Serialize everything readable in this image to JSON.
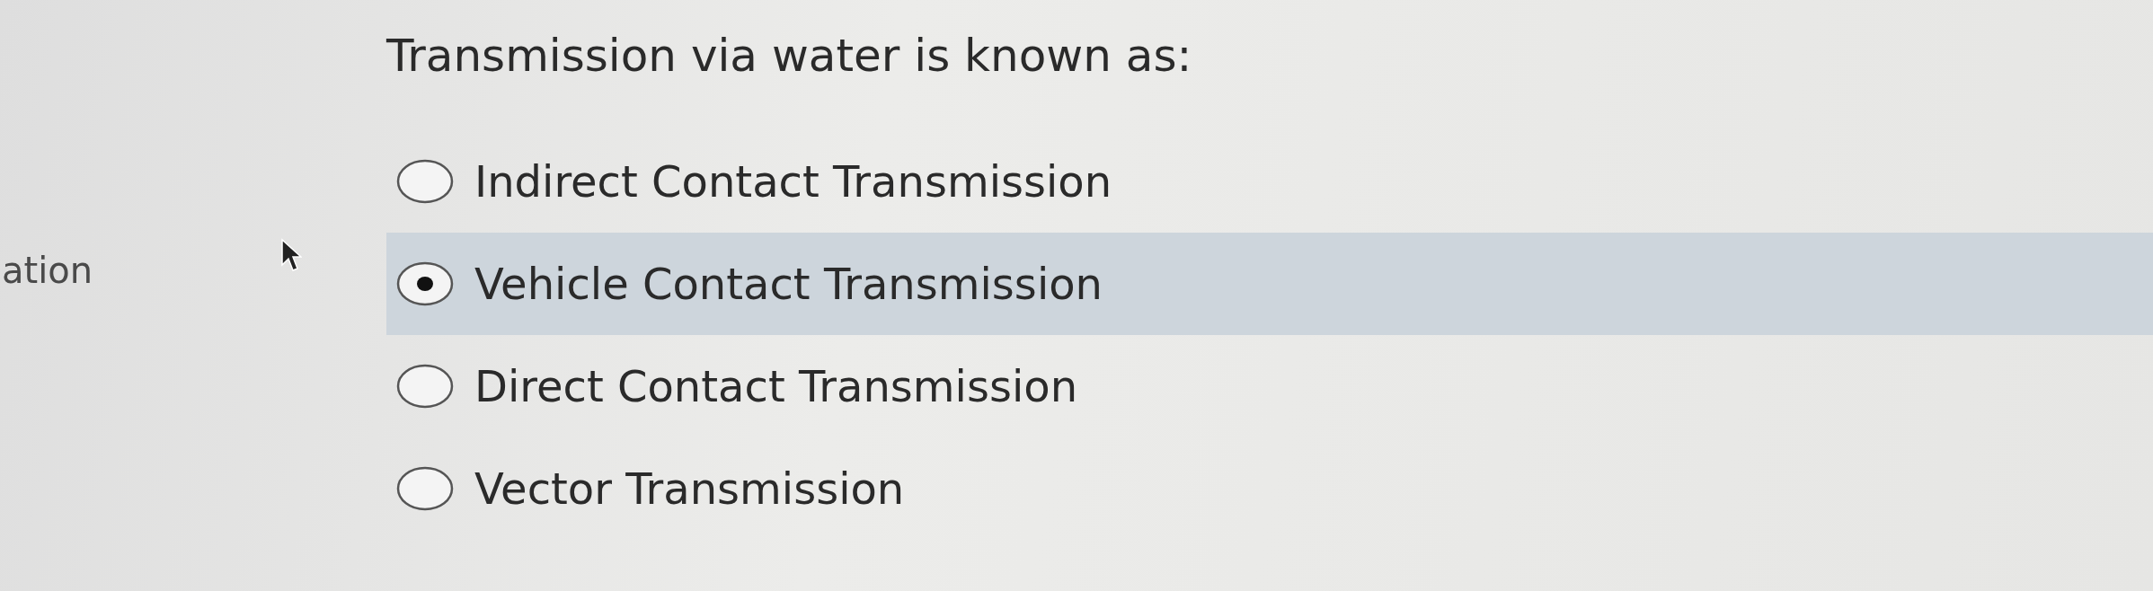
{
  "side_label": "ation",
  "question": "Transmission via water is known as:",
  "options": [
    {
      "label": "Indirect Contact Transmission",
      "selected": false
    },
    {
      "label": "Vehicle Contact Transmission",
      "selected": true
    },
    {
      "label": "Direct Contact Transmission",
      "selected": false
    },
    {
      "label": "Vector Transmission",
      "selected": false
    }
  ]
}
